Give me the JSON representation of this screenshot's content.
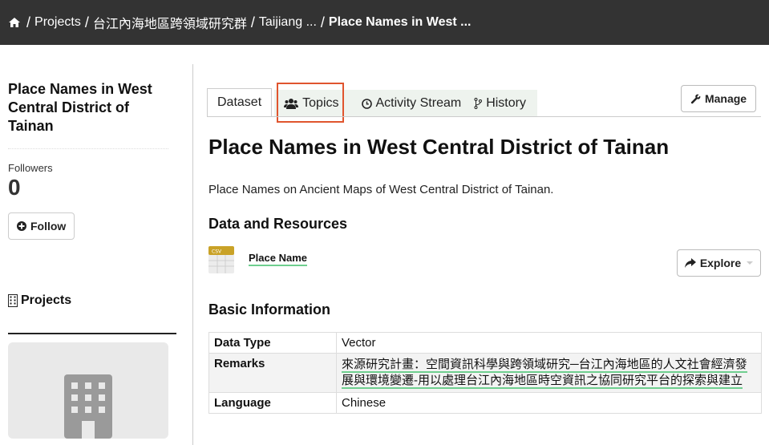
{
  "breadcrumb": {
    "home_icon": "home-icon",
    "items": [
      "Projects",
      "台江內海地區跨領域研究群",
      "Taijiang ...",
      "Place Names in West ..."
    ],
    "separator": "/"
  },
  "sidebar": {
    "title": "Place Names in West Central District of Tainan",
    "followers_label": "Followers",
    "followers_count": "0",
    "follow_label": "Follow",
    "projects_heading": "Projects"
  },
  "tabs": {
    "dataset": "Dataset",
    "topics": "Topics",
    "activity": "Activity Stream",
    "history": "History"
  },
  "manage_label": "Manage",
  "main": {
    "title": "Place Names in West Central District of Tainan",
    "description": "Place Names on Ancient Maps of West Central District of Tainan.",
    "resources_heading": "Data and Resources",
    "resource_name": "Place Name",
    "resource_format": "CSV",
    "explore_label": "Explore",
    "basic_info_heading": "Basic Information"
  },
  "info_rows": [
    {
      "key": "Data Type",
      "value": "Vector"
    },
    {
      "key": "Remarks",
      "value": "來源研究計畫：空間資訊科學與跨領域研究─台江內海地區的人文社會經濟發展與環境變遷-用以處理台江內海地區時空資訊之協同研究平台的探索與建立"
    },
    {
      "key": "Language",
      "value": "Chinese"
    }
  ],
  "colors": {
    "topbar": "#333333",
    "tab_group_bg": "#eef3ee",
    "highlight": "#e0552e",
    "link_underline": "#6fcf8f"
  }
}
